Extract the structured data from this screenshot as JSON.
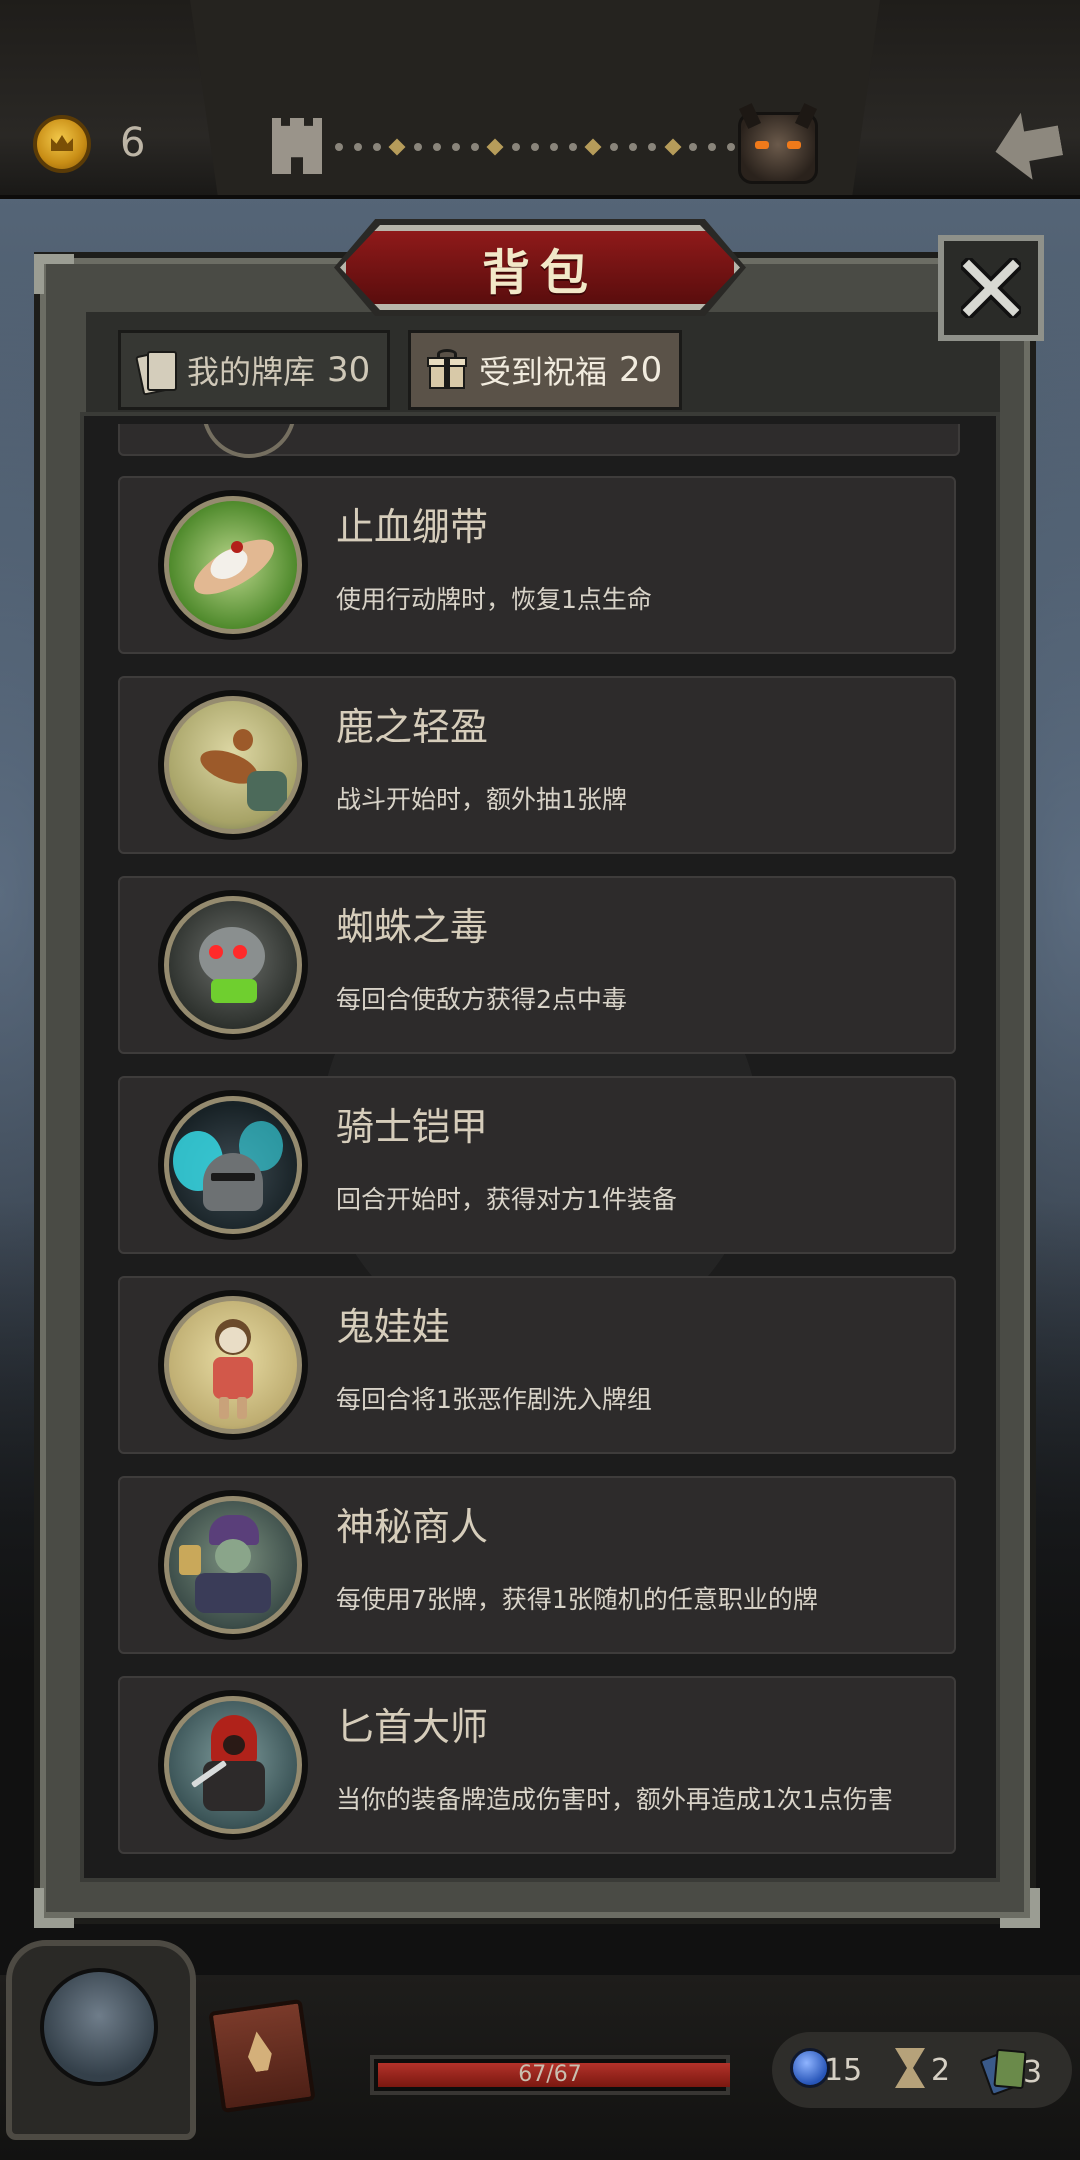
{
  "header": {
    "coins": "6",
    "progress_track": [
      "dot",
      "dot",
      "dot",
      "diamond",
      "dot",
      "dot",
      "dot",
      "dot",
      "diamond",
      "dot",
      "dot",
      "dot",
      "dot",
      "diamond",
      "dot",
      "dot",
      "dot",
      "diamond",
      "dot",
      "dot",
      "dot"
    ]
  },
  "panel": {
    "title": "背包",
    "tabs": [
      {
        "label": "我的牌库",
        "count": "30",
        "active": false
      },
      {
        "label": "受到祝福",
        "count": "20",
        "active": true
      }
    ],
    "items": [
      {
        "name": "止血绷带",
        "desc": "使用行动牌时，恢复1点生命",
        "icon": "bandaged-arm-icon"
      },
      {
        "name": "鹿之轻盈",
        "desc": "战斗开始时，额外抽1张牌",
        "icon": "leaping-deer-icon"
      },
      {
        "name": "蜘蛛之毒",
        "desc": "每回合使敌方获得2点中毒",
        "icon": "venom-skull-icon"
      },
      {
        "name": "骑士铠甲",
        "desc": "回合开始时，获得对方1件装备",
        "icon": "knight-helmet-icon"
      },
      {
        "name": "鬼娃娃",
        "desc": "每回合将1张恶作剧洗入牌组",
        "icon": "voodoo-doll-icon"
      },
      {
        "name": "神秘商人",
        "desc": "每使用7张牌，获得1张随机的任意职业的牌",
        "icon": "mysterious-merchant-icon"
      },
      {
        "name": "匕首大师",
        "desc": "当你的装备牌造成伤害时，额外再造成1次1点伤害",
        "icon": "dagger-master-icon"
      }
    ]
  },
  "footer": {
    "hp_text": "67/67",
    "hp_fraction": 1.0,
    "stats": {
      "orb": "15",
      "hourglass": "2",
      "cards": "3"
    }
  },
  "colors": {
    "title_plate": "#8f1a1a",
    "active_tab": "#5a5248",
    "hp_bar": "#b3322a",
    "item_bg": "#2d2b2b"
  }
}
